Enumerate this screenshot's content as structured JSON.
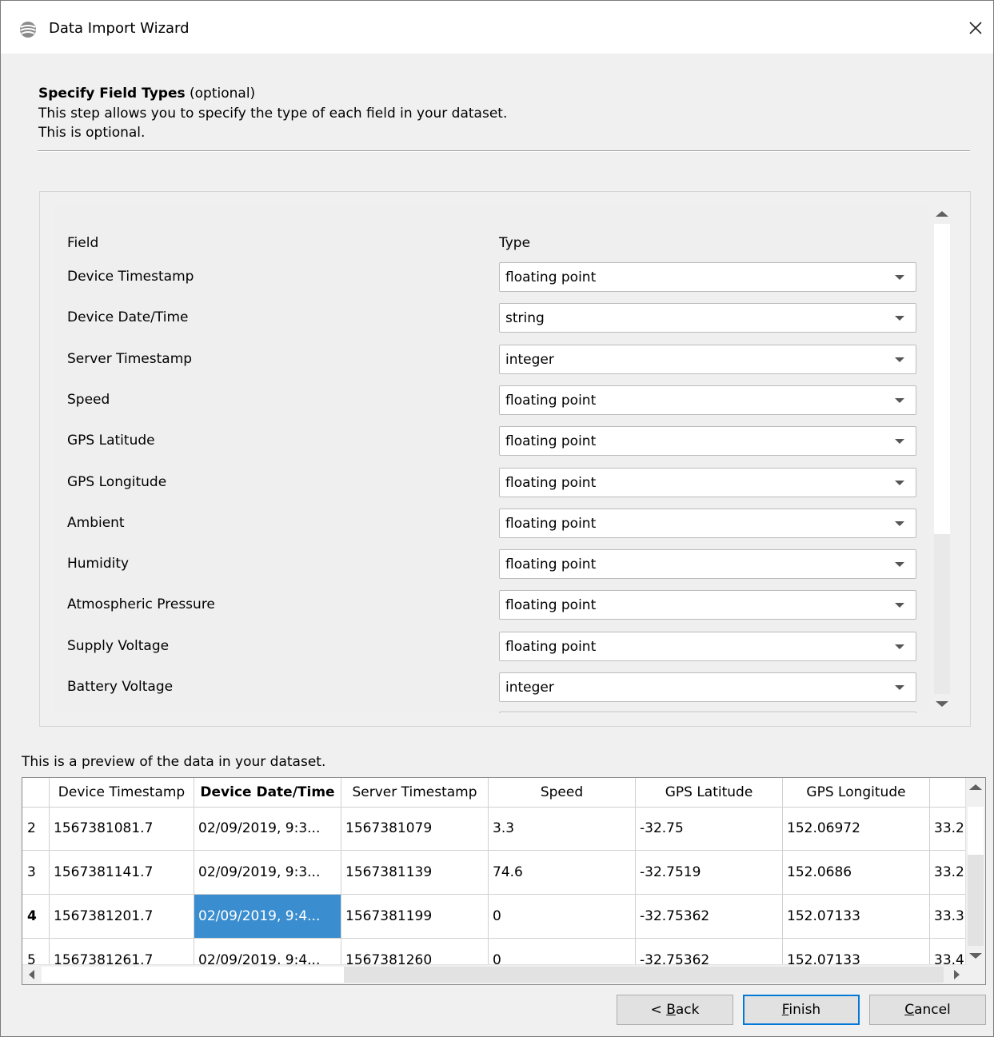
{
  "window": {
    "title": "Data Import Wizard",
    "icon": "app-globe-icon"
  },
  "header": {
    "title_bold": "Specify Field Types",
    "title_suffix": " (optional)",
    "description_line1": "This step allows you to specify the type of each field in your dataset.",
    "description_line2": "This is optional."
  },
  "types_table": {
    "field_header": "Field",
    "type_header": "Type",
    "rows": [
      {
        "field": "Device Timestamp",
        "type": "floating point"
      },
      {
        "field": "Device Date/Time",
        "type": "string"
      },
      {
        "field": "Server Timestamp",
        "type": "integer"
      },
      {
        "field": "Speed",
        "type": "floating point"
      },
      {
        "field": "GPS Latitude",
        "type": "floating point"
      },
      {
        "field": "GPS Longitude",
        "type": "floating point"
      },
      {
        "field": "Ambient",
        "type": "floating point"
      },
      {
        "field": "Humidity",
        "type": "floating point"
      },
      {
        "field": "Atmospheric Pressure",
        "type": "floating point"
      },
      {
        "field": "Supply Voltage",
        "type": "floating point"
      },
      {
        "field": "Battery Voltage",
        "type": "integer"
      }
    ]
  },
  "preview": {
    "label": "This is a preview of the data in your dataset.",
    "columns": [
      "Device Timestamp",
      "Device Date/Time",
      "Server Timestamp",
      "Speed",
      "GPS Latitude",
      "GPS Longitude",
      ""
    ],
    "selected_column": "Device Date/Time",
    "rows": [
      {
        "num": "2",
        "cells": [
          "1567381081.7",
          "02/09/2019, 9:3...",
          "1567381079",
          "3.3",
          "-32.75",
          "152.06972",
          "33.2"
        ]
      },
      {
        "num": "3",
        "cells": [
          "1567381141.7",
          "02/09/2019, 9:3...",
          "1567381139",
          "74.6",
          "-32.7519",
          "152.0686",
          "33.2"
        ]
      },
      {
        "num": "4",
        "cells": [
          "1567381201.7",
          "02/09/2019, 9:4...",
          "1567381199",
          "0",
          "-32.75362",
          "152.07133",
          "33.3"
        ],
        "selected": true
      },
      {
        "num": "5",
        "cells": [
          "1567381261.7",
          "02/09/2019, 9:4...",
          "1567381260",
          "0",
          "-32.75362",
          "152.07133",
          "33.4"
        ]
      }
    ]
  },
  "buttons": {
    "back": {
      "prefix": "< ",
      "mnemonic": "B",
      "rest": "ack"
    },
    "finish": {
      "prefix": "",
      "mnemonic": "F",
      "rest": "inish"
    },
    "cancel": {
      "prefix": "",
      "mnemonic": "C",
      "rest": "ancel"
    }
  }
}
